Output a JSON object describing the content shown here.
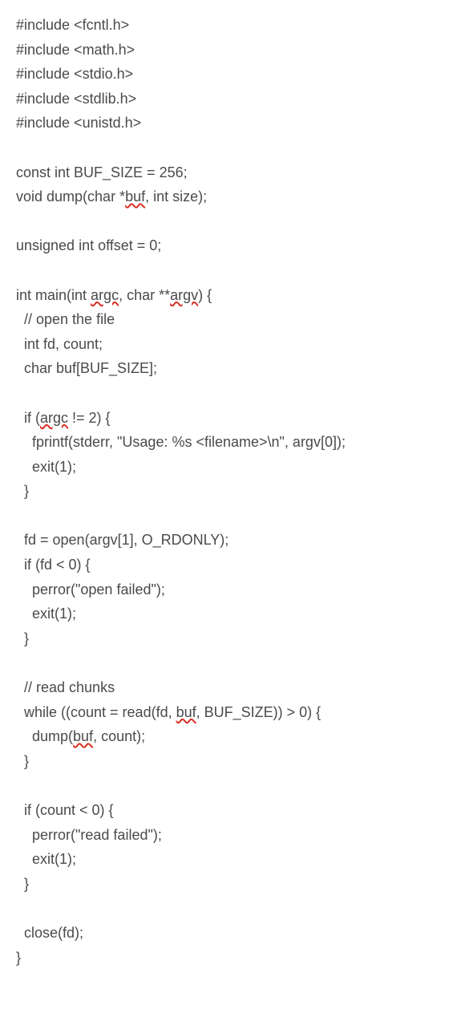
{
  "code": {
    "lines": [
      {
        "segments": [
          {
            "t": "#include <fcntl.h>"
          }
        ]
      },
      {
        "segments": [
          {
            "t": "#include <math.h>"
          }
        ]
      },
      {
        "segments": [
          {
            "t": "#include <stdio.h>"
          }
        ]
      },
      {
        "segments": [
          {
            "t": "#include <stdlib.h>"
          }
        ]
      },
      {
        "segments": [
          {
            "t": "#include <unistd.h>"
          }
        ]
      },
      {
        "empty": true
      },
      {
        "segments": [
          {
            "t": "const int BUF_SIZE = 256;"
          }
        ]
      },
      {
        "segments": [
          {
            "t": "void dump(char *"
          },
          {
            "t": "buf",
            "sq": true
          },
          {
            "t": ", int size);"
          }
        ]
      },
      {
        "empty": true
      },
      {
        "segments": [
          {
            "t": "unsigned int offset = 0;"
          }
        ]
      },
      {
        "empty": true
      },
      {
        "segments": [
          {
            "t": "int main(int "
          },
          {
            "t": "argc",
            "sq": true
          },
          {
            "t": ", char **"
          },
          {
            "t": "argv",
            "sq": true
          },
          {
            "t": ") {"
          }
        ]
      },
      {
        "segments": [
          {
            "t": "  // open the file"
          }
        ]
      },
      {
        "segments": [
          {
            "t": "  int fd, count;"
          }
        ]
      },
      {
        "segments": [
          {
            "t": "  char buf[BUF_SIZE];"
          }
        ]
      },
      {
        "empty": true
      },
      {
        "segments": [
          {
            "t": "  if ("
          },
          {
            "t": "argc",
            "sq": true
          },
          {
            "t": " != 2) {"
          }
        ]
      },
      {
        "segments": [
          {
            "t": "    fprintf(stderr, \"Usage: %s <filename>\\n\", argv[0]);"
          }
        ]
      },
      {
        "segments": [
          {
            "t": "    exit(1);"
          }
        ]
      },
      {
        "segments": [
          {
            "t": "  }"
          }
        ]
      },
      {
        "empty": true
      },
      {
        "segments": [
          {
            "t": "  fd = open(argv[1], O_RDONLY);"
          }
        ]
      },
      {
        "segments": [
          {
            "t": "  if (fd < 0) {"
          }
        ]
      },
      {
        "segments": [
          {
            "t": "    perror(\"open failed\");"
          }
        ]
      },
      {
        "segments": [
          {
            "t": "    exit(1);"
          }
        ]
      },
      {
        "segments": [
          {
            "t": "  }"
          }
        ]
      },
      {
        "empty": true
      },
      {
        "segments": [
          {
            "t": "  // read chunks"
          }
        ]
      },
      {
        "segments": [
          {
            "t": "  while ((count = read(fd, "
          },
          {
            "t": "buf",
            "sq": true
          },
          {
            "t": ", BUF_SIZE)) > 0) {"
          }
        ]
      },
      {
        "segments": [
          {
            "t": "    dump("
          },
          {
            "t": "buf",
            "sq": true
          },
          {
            "t": ", count);"
          }
        ]
      },
      {
        "segments": [
          {
            "t": "  }"
          }
        ]
      },
      {
        "empty": true
      },
      {
        "segments": [
          {
            "t": "  if (count < 0) {"
          }
        ]
      },
      {
        "segments": [
          {
            "t": "    perror(\"read failed\");"
          }
        ]
      },
      {
        "segments": [
          {
            "t": "    exit(1);"
          }
        ]
      },
      {
        "segments": [
          {
            "t": "  }"
          }
        ]
      },
      {
        "empty": true
      },
      {
        "segments": [
          {
            "t": "  close(fd);"
          }
        ]
      },
      {
        "segments": [
          {
            "t": "}"
          }
        ]
      }
    ]
  }
}
